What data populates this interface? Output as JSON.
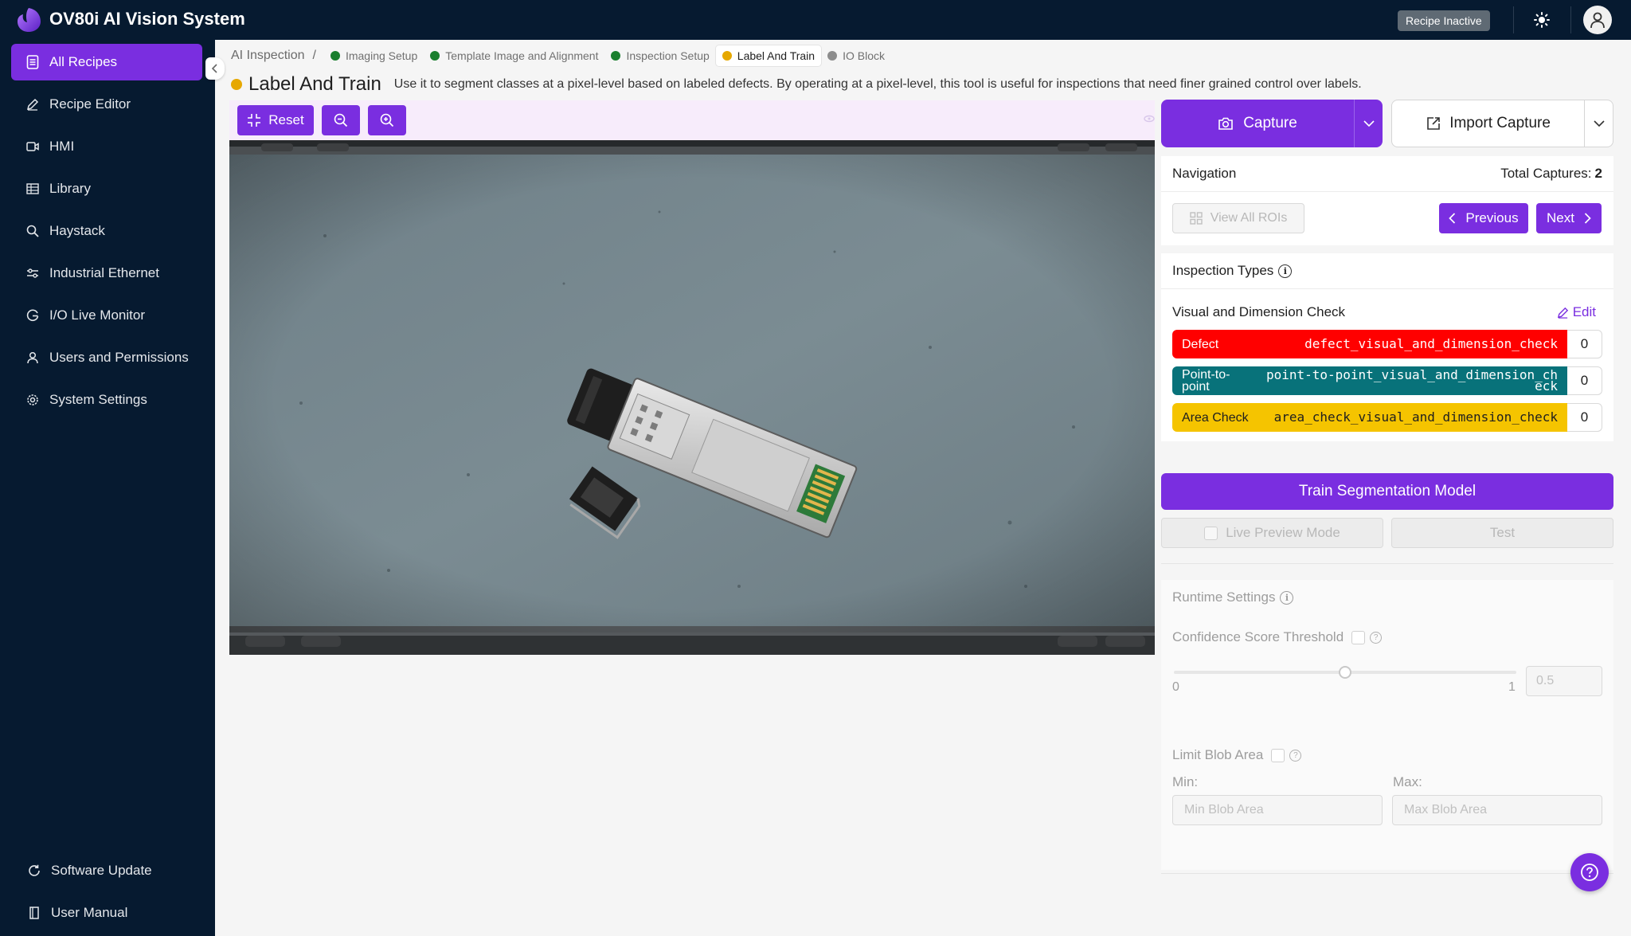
{
  "app": {
    "title": "OV80i AI Vision System",
    "recipe_status": "Recipe Inactive"
  },
  "sidebar": {
    "items": [
      {
        "label": "All Recipes",
        "icon": "document-list-icon",
        "active": true
      },
      {
        "label": "Recipe Editor",
        "icon": "pencil-icon"
      },
      {
        "label": "HMI",
        "icon": "video-camera-icon"
      },
      {
        "label": "Library",
        "icon": "table-icon"
      },
      {
        "label": "Haystack",
        "icon": "search-icon"
      },
      {
        "label": "Industrial Ethernet",
        "icon": "network-icon"
      },
      {
        "label": "I/O Live Monitor",
        "icon": "gauge-icon"
      },
      {
        "label": "Users and Permissions",
        "icon": "user-icon"
      },
      {
        "label": "System Settings",
        "icon": "gear-icon"
      }
    ],
    "bottom_items": [
      {
        "label": "Software Update",
        "icon": "refresh-icon"
      },
      {
        "label": "User Manual",
        "icon": "book-icon"
      }
    ]
  },
  "breadcrumb": {
    "root": "AI Inspection",
    "separator": "/",
    "steps": [
      {
        "label": "Imaging Setup",
        "color": "#1a7f2e"
      },
      {
        "label": "Template Image and Alignment",
        "color": "#1a7f2e"
      },
      {
        "label": "Inspection Setup",
        "color": "#1a7f2e"
      },
      {
        "label": "Label And Train",
        "color": "#e6a800",
        "active": true
      },
      {
        "label": "IO Block",
        "color": "#8c8c8c"
      }
    ]
  },
  "page": {
    "title": "Label And Train",
    "description": "Use it to segment classes at a pixel-level based on labeled defects. By operating at a pixel-level, this tool is useful for inspections that need finer grained control over labels."
  },
  "toolbar": {
    "reset_label": "Reset"
  },
  "capture": {
    "capture_label": "Capture",
    "import_label": "Import Capture"
  },
  "navigation": {
    "title": "Navigation",
    "total_label": "Total Captures:",
    "total_value": "2",
    "view_all_label": "View All ROIs",
    "previous_label": "Previous",
    "next_label": "Next"
  },
  "inspection_types": {
    "title": "Inspection Types",
    "group_name": "Visual and Dimension Check",
    "edit_label": "Edit",
    "rows": [
      {
        "short": "Defect",
        "name": "defect_visual_and_dimension_check",
        "count": "0",
        "color": "#ff0000"
      },
      {
        "short": "Point-to-point",
        "name": "point-to-point_visual_and_dimension_check",
        "count": "0",
        "color": "#08727a"
      },
      {
        "short": "Area Check",
        "name": "area_check_visual_and_dimension_check",
        "count": "0",
        "color": "#f5c400"
      }
    ]
  },
  "actions": {
    "train_label": "Train Segmentation Model",
    "live_preview_label": "Live Preview Mode",
    "test_label": "Test"
  },
  "runtime": {
    "title": "Runtime Settings",
    "confidence_label": "Confidence Score Threshold",
    "slider_min": "0",
    "slider_max": "1",
    "slider_value": "0.5",
    "blob_label": "Limit Blob Area",
    "min_label": "Min:",
    "max_label": "Max:",
    "min_placeholder": "Min Blob Area",
    "max_placeholder": "Max Blob Area"
  },
  "colors": {
    "accent": "#7a2ee0",
    "sidebar_bg": "#061a30"
  }
}
